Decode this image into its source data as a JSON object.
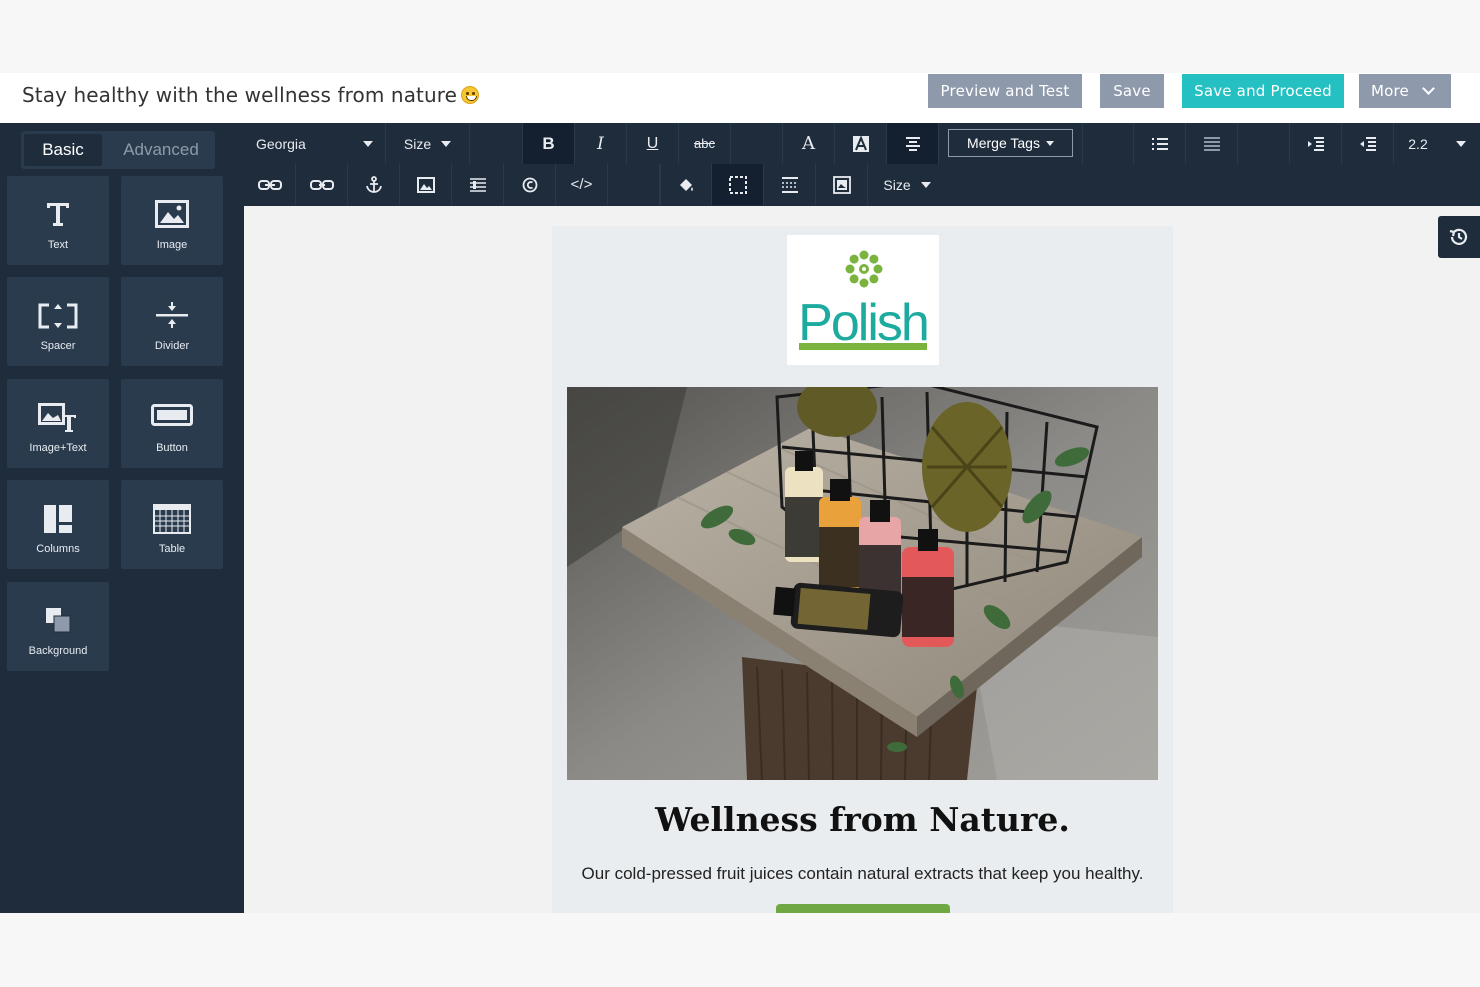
{
  "header": {
    "subject": "Stay healthy with the wellness from nature",
    "buttons": {
      "preview": "Preview and Test",
      "save": "Save",
      "save_proceed": "Save and Proceed",
      "more": "More"
    }
  },
  "sidebar": {
    "tabs": [
      "Basic",
      "Advanced"
    ],
    "active_tab": "Basic",
    "tiles": [
      {
        "label": "Text",
        "icon": "text-icon"
      },
      {
        "label": "Image",
        "icon": "image-icon"
      },
      {
        "label": "Spacer",
        "icon": "spacer-icon"
      },
      {
        "label": "Divider",
        "icon": "divider-icon"
      },
      {
        "label": "Image+Text",
        "icon": "image-text-icon"
      },
      {
        "label": "Button",
        "icon": "button-icon"
      },
      {
        "label": "Columns",
        "icon": "columns-icon"
      },
      {
        "label": "Table",
        "icon": "table-icon"
      },
      {
        "label": "Background",
        "icon": "background-icon"
      }
    ]
  },
  "toolbar": {
    "font": "Georgia",
    "size": "Size",
    "bold": "B",
    "italic": "I",
    "underline": "U",
    "strike": "abc",
    "font_color": "A",
    "merge_tags": "Merge Tags",
    "line_height": "2.2",
    "size2": "Size",
    "code": "</>"
  },
  "email": {
    "logo_text": "Polish",
    "headline": "Wellness from Nature.",
    "body": "Our cold-pressed fruit juices contain natural extracts that keep you healthy."
  },
  "colors": {
    "sidebar_bg": "#1e2c3c",
    "tile_bg": "#2b3b4e",
    "button_gray": "#8e9aab",
    "button_teal": "#25c0c1",
    "logo_teal": "#1daa9f",
    "logo_green": "#7ab33d",
    "cta_green": "#6fa842"
  }
}
